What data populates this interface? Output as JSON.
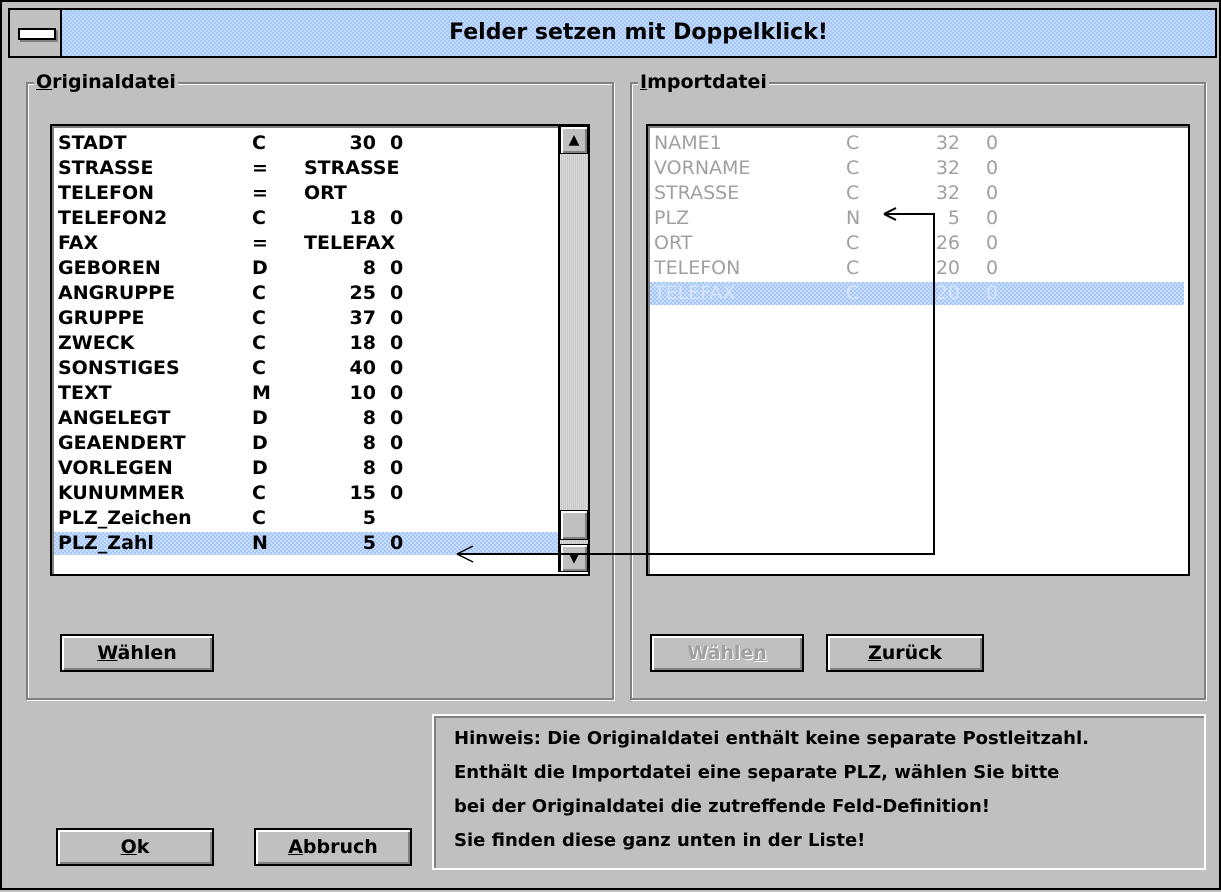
{
  "title": "Felder setzen mit Doppelklick!",
  "left_group": {
    "label_accel": "O",
    "label_rest": "riginaldatei",
    "rows": [
      {
        "name": "STADT",
        "type": "C",
        "len": "30",
        "dec": "0"
      },
      {
        "name": "STRASSE",
        "type": "=",
        "len": "STRASSE",
        "dec": ""
      },
      {
        "name": "TELEFON",
        "type": "=",
        "len": "ORT",
        "dec": ""
      },
      {
        "name": "TELEFON2",
        "type": "C",
        "len": "18",
        "dec": "0"
      },
      {
        "name": "FAX",
        "type": "=",
        "len": "TELEFAX",
        "dec": ""
      },
      {
        "name": "GEBOREN",
        "type": "D",
        "len": "8",
        "dec": "0"
      },
      {
        "name": "ANGRUPPE",
        "type": "C",
        "len": "25",
        "dec": "0"
      },
      {
        "name": "GRUPPE",
        "type": "C",
        "len": "37",
        "dec": "0"
      },
      {
        "name": "ZWECK",
        "type": "C",
        "len": "18",
        "dec": "0"
      },
      {
        "name": "SONSTIGES",
        "type": "C",
        "len": "40",
        "dec": "0"
      },
      {
        "name": "TEXT",
        "type": "M",
        "len": "10",
        "dec": "0"
      },
      {
        "name": "ANGELEGT",
        "type": "D",
        "len": "8",
        "dec": "0"
      },
      {
        "name": "GEAENDERT",
        "type": "D",
        "len": "8",
        "dec": "0"
      },
      {
        "name": "VORLEGEN",
        "type": "D",
        "len": "8",
        "dec": "0"
      },
      {
        "name": "KUNUMMER",
        "type": "C",
        "len": "15",
        "dec": "0"
      },
      {
        "name": "PLZ_Zeichen",
        "type": "C",
        "len": "5",
        "dec": ""
      },
      {
        "name": "PLZ_Zahl",
        "type": "N",
        "len": "5",
        "dec": "0"
      }
    ],
    "selected_index": 16,
    "button_accel": "W",
    "button_rest": "ählen"
  },
  "right_group": {
    "label_accel": "I",
    "label_rest": "mportdatei",
    "rows": [
      {
        "name": "NAME1",
        "type": "C",
        "len": "32",
        "dec": "0"
      },
      {
        "name": "VORNAME",
        "type": "C",
        "len": "32",
        "dec": "0"
      },
      {
        "name": "STRASSE",
        "type": "C",
        "len": "32",
        "dec": "0"
      },
      {
        "name": "PLZ",
        "type": "N",
        "len": "5",
        "dec": "0"
      },
      {
        "name": "ORT",
        "type": "C",
        "len": "26",
        "dec": "0"
      },
      {
        "name": "TELEFON",
        "type": "C",
        "len": "20",
        "dec": "0"
      },
      {
        "name": "TELEFAX",
        "type": "C",
        "len": "20",
        "dec": "0"
      }
    ],
    "selected_index": 6,
    "choose_button_pre": "Wähle",
    "choose_button_accel": "n",
    "back_button_accel": "Z",
    "back_button_rest": "urück"
  },
  "ok_button": {
    "accel": "O",
    "rest": "k"
  },
  "cancel_button": {
    "accel": "A",
    "rest": "bbruch"
  },
  "hint_lines": [
    "Hinweis: Die Originaldatei enthält keine separate Postleitzahl.",
    "Enthält die Importdatei eine separate PLZ, wählen Sie bitte",
    "bei der Originaldatei die zutreffende Feld-Definition!",
    "Sie finden diese ganz unten in der Liste!"
  ],
  "icons": {
    "scroll_up": "▲",
    "scroll_down": "▼"
  }
}
